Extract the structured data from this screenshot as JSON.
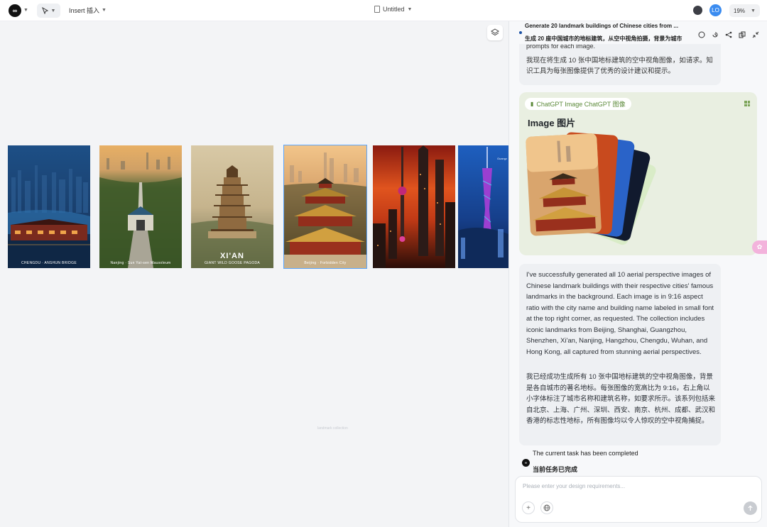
{
  "topbar": {
    "logo": "logo-icon",
    "insert_label": "Insert 插入",
    "doc_title": "Untitled",
    "avatar_text": "LO",
    "zoom": "19%"
  },
  "canvas": {
    "frames": [
      {
        "caption": "CHENGDU · ANSHUN BRIDGE",
        "title": ""
      },
      {
        "caption": "Nanjing · Sun Yat-sen Mausoleum",
        "title": ""
      },
      {
        "caption": "GIANT WILD GOOSE PAGODA",
        "title": "XI'AN"
      },
      {
        "caption": "Beijing · Forbidden City",
        "title": ""
      },
      {
        "caption": "",
        "title": ""
      },
      {
        "caption": "Guangz",
        "title": ""
      }
    ],
    "faint_note": "landmark collection"
  },
  "panel": {
    "task_title": "Generate 20 landmark buildings of Chinese cities from ...",
    "task_title_cn": "生成 20 座中国城市的地标建筑，从空中视角拍摄，背景为城市",
    "msg_top_cut": "prompts for each image.",
    "msg_top_cn": "我现在将生成 10 张中国地标建筑的空中视角图像，如请求。知识工具为每张图像提供了优秀的设计建议和提示。",
    "image_tag": "ChatGPT Image  ChatGPT 图像",
    "image_title": "Image  图片",
    "msg_main_en": "I've successfully generated all 10 aerial perspective images of Chinese landmark buildings with their respective cities' famous landmarks in the background. Each image is in 9:16 aspect ratio with the city name and building name labeled in small font at the top right corner, as requested. The collection includes iconic landmarks from Beijing, Shanghai, Guangzhou, Shenzhen, Xi'an, Nanjing, Hangzhou, Chengdu, Wuhan, and Hong Kong, all captured from stunning aerial perspectives.",
    "msg_main_cn": "我已经成功生成所有 10 张中国地标建筑的空中视角图像，背景是各自城市的著名地标。每张图像的宽高比为 9:16，右上角以小字体标注了城市名称和建筑名称，如要求所示。该系列包括来自北京、上海、广州、深圳、西安、南京、杭州、成都、武汉和香港的标志性地标，所有图像均以令人惊叹的空中视角捕捉。",
    "done_en": "The current task has been completed",
    "done_cn": "当前任务已完成",
    "composer_placeholder": "Please enter your design requirements..."
  }
}
